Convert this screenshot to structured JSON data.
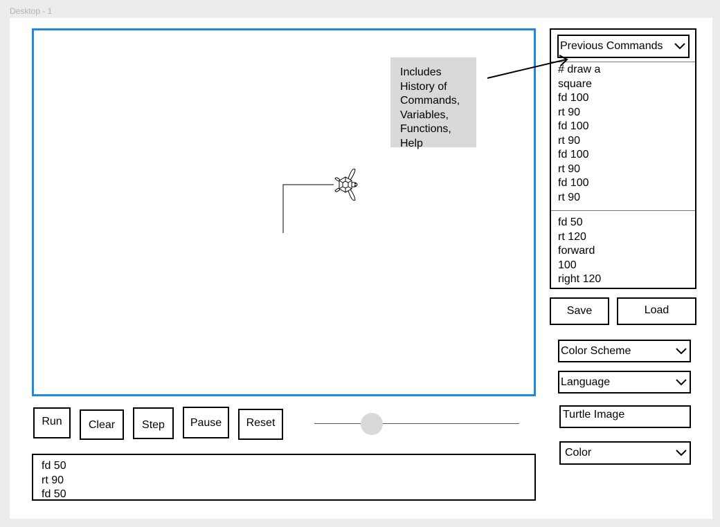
{
  "frame_label": "Desktop - 1",
  "note_lines": [
    "Includes",
    "History of",
    "Commands,",
    "Variables,",
    "Functions,",
    "Help"
  ],
  "history": {
    "select_label": "Previous Commands",
    "group1": [
      "# draw a",
      "square",
      "fd 100",
      "rt 90",
      "fd 100",
      "rt 90",
      "fd 100",
      "rt 90",
      "fd 100",
      "rt 90"
    ],
    "group2": [
      "fd 50",
      "rt 120",
      "forward",
      "100",
      "right 120"
    ]
  },
  "file_buttons": {
    "save": "Save",
    "load": "Load"
  },
  "settings": {
    "color_scheme": "Color Scheme",
    "language": "Language",
    "turtle_image": "Turtle Image",
    "color": "Color"
  },
  "controls": {
    "run": "Run",
    "clear": "Clear",
    "step": "Step",
    "pause": "Pause",
    "reset": "Reset"
  },
  "speed_slider": {
    "value_fraction": 0.28
  },
  "console_lines": [
    "fd 50",
    "rt 90",
    "fd 50"
  ],
  "icons": {
    "chevron": "chevron-down-icon",
    "turtle": "turtle-icon"
  },
  "colors": {
    "canvas_border": "#1e88e5",
    "note_bg": "#d9d9d9",
    "thumb": "#d9d9d9"
  }
}
